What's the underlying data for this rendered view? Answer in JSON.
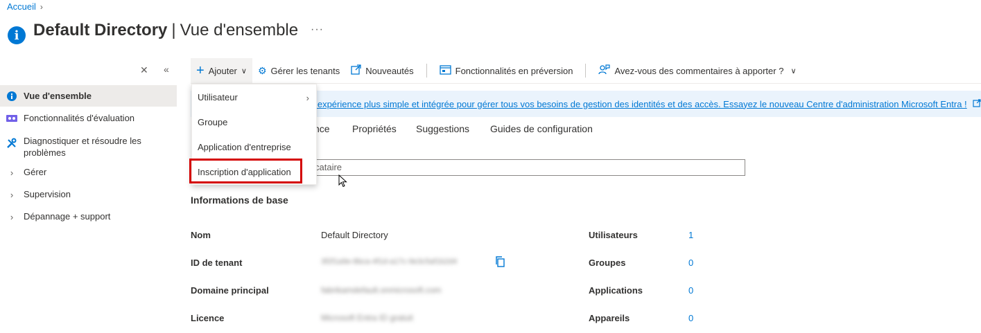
{
  "breadcrumb": {
    "home": "Accueil"
  },
  "header": {
    "title_strong": "Default Directory",
    "title_sep": "|",
    "title_rest": "Vue d'ensemble",
    "more": "···"
  },
  "sidebar": {
    "items": [
      {
        "label": "Vue d'ensemble",
        "icon": "info-icon"
      },
      {
        "label": "Fonctionnalités d'évaluation",
        "icon": "preview-features-icon"
      },
      {
        "label": "Diagnostiquer et résoudre les problèmes",
        "icon": "wrench-icon"
      },
      {
        "label": "Gérer",
        "icon": "chevron-right-icon"
      },
      {
        "label": "Supervision",
        "icon": "chevron-right-icon"
      },
      {
        "label": "Dépannage + support",
        "icon": "chevron-right-icon"
      }
    ]
  },
  "toolbar": {
    "add": "Ajouter",
    "manage_tenants": "Gérer les tenants",
    "whats_new": "Nouveautés",
    "preview_features": "Fonctionnalités en préversion",
    "feedback": "Avez-vous des commentaires à apporter ?"
  },
  "add_menu": {
    "items": [
      "Utilisateur",
      "Groupe",
      "Application d'entreprise",
      "Inscription d'application"
    ]
  },
  "banner": {
    "text": "e expérience plus simple et intégrée pour gérer tous vos besoins de gestion des identités et des accès. Essayez le nouveau Centre d'administration Microsoft Entra !"
  },
  "tabs": [
    "nce",
    "Propriétés",
    "Suggestions",
    "Guides de configuration"
  ],
  "search": {
    "value": "cataire"
  },
  "basic_info": {
    "title": "Informations de base",
    "props": [
      {
        "label": "Nom",
        "value": "Default Directory"
      },
      {
        "label": "ID de tenant",
        "value": "3f2f1a9e-8bca-4f1d-a17c-9e3c5af1b2d4"
      },
      {
        "label": "Domaine principal",
        "value": "fabrikamdefault.onmicrosoft.com"
      },
      {
        "label": "Licence",
        "value": "Microsoft Entra ID gratuit"
      }
    ],
    "stats": [
      {
        "label": "Utilisateurs",
        "value": "1"
      },
      {
        "label": "Groupes",
        "value": "0"
      },
      {
        "label": "Applications",
        "value": "0"
      },
      {
        "label": "Appareils",
        "value": "0"
      }
    ]
  },
  "colors": {
    "accent": "#0078d4",
    "highlight": "#d40000"
  }
}
